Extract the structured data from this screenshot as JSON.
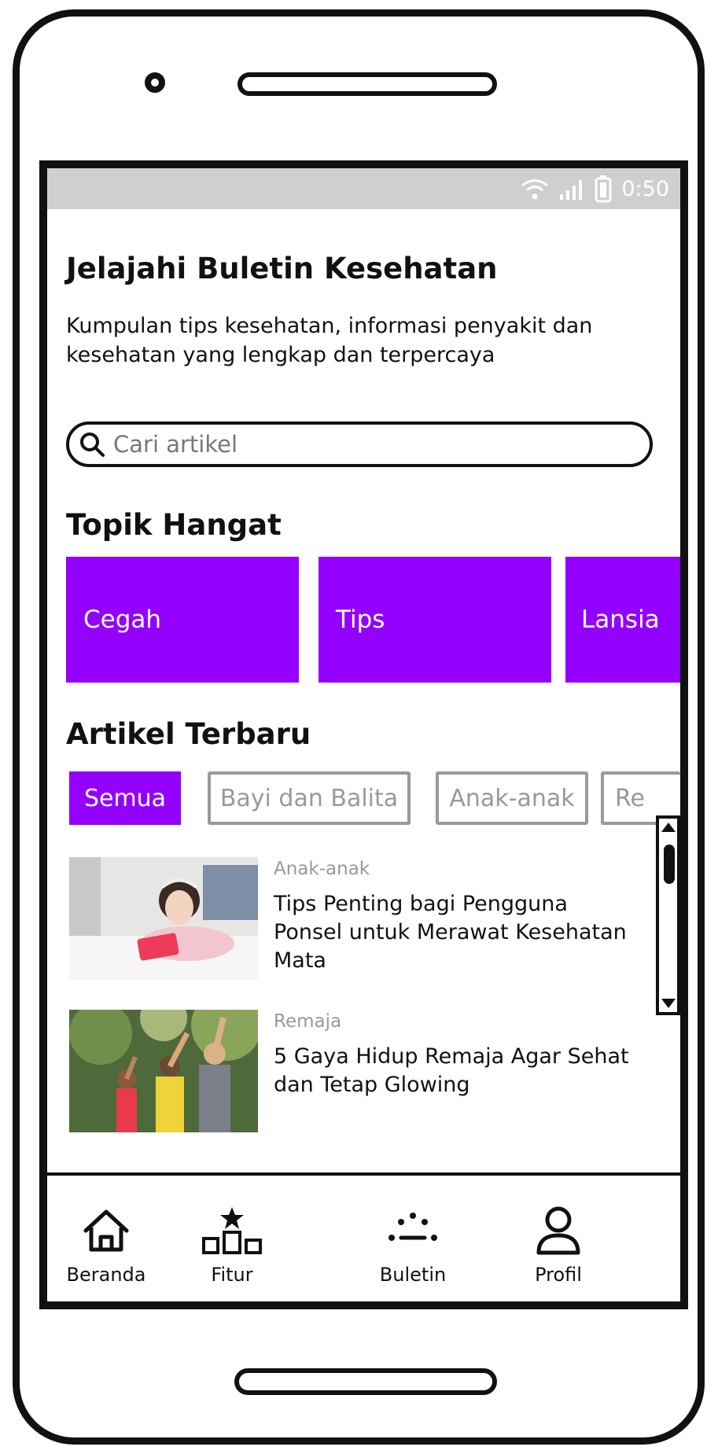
{
  "status_bar": {
    "time": "0:50"
  },
  "header": {
    "title": "Jelajahi Buletin Kesehatan",
    "subtitle": "Kumpulan tips kesehatan, informasi penyakit dan kesehatan yang lengkap dan terpercaya"
  },
  "search": {
    "placeholder": "Cari artikel"
  },
  "hot_topics": {
    "title": "Topik Hangat",
    "items": [
      {
        "label": "Cegah"
      },
      {
        "label": "Tips"
      },
      {
        "label": "Lansia"
      }
    ]
  },
  "latest": {
    "title": "Artikel Terbaru",
    "filters": [
      {
        "label": "Semua",
        "active": true
      },
      {
        "label": "Bayi dan Balita",
        "active": false
      },
      {
        "label": "Anak-anak",
        "active": false
      },
      {
        "label": "Re",
        "active": false
      }
    ],
    "articles": [
      {
        "category": "Anak-anak",
        "title": "Tips Penting bagi Pengguna Ponsel untuk Merawat Kesehatan Mata"
      },
      {
        "category": "Remaja",
        "title": "5 Gaya Hidup Remaja Agar Sehat dan Tetap Glowing"
      }
    ]
  },
  "bottom_nav": {
    "items": [
      {
        "label": "Beranda",
        "icon": "home-icon"
      },
      {
        "label": "Fitur",
        "icon": "podium-star-icon"
      },
      {
        "label": "Buletin",
        "icon": "bulletin-icon"
      },
      {
        "label": "Profil",
        "icon": "user-icon"
      }
    ]
  },
  "colors": {
    "accent": "#9400ff",
    "status_bar": "#cfcfcf",
    "muted": "#999999"
  }
}
